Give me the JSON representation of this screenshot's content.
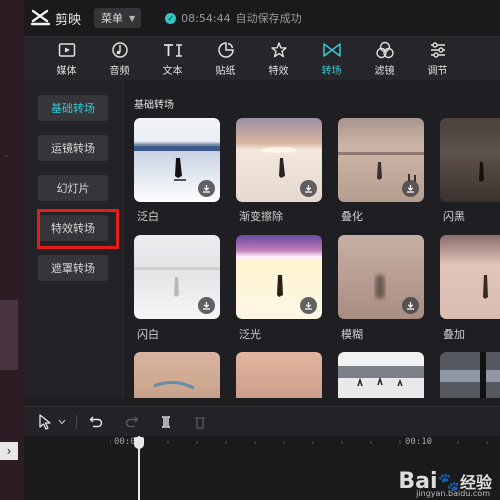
{
  "app": {
    "name": "剪映",
    "menu_label": "菜单",
    "save_time": "08:54:44",
    "save_text": "自动保存成功"
  },
  "toolbar": [
    {
      "label": "媒体",
      "icon": "media-icon"
    },
    {
      "label": "音频",
      "icon": "audio-icon"
    },
    {
      "label": "文本",
      "icon": "text-icon"
    },
    {
      "label": "贴纸",
      "icon": "sticker-icon"
    },
    {
      "label": "特效",
      "icon": "effects-icon"
    },
    {
      "label": "转场",
      "icon": "transition-icon",
      "active": true
    },
    {
      "label": "滤镜",
      "icon": "filter-icon"
    },
    {
      "label": "调节",
      "icon": "adjust-icon"
    }
  ],
  "sidebar": {
    "items": [
      {
        "label": "基础转场",
        "active": true
      },
      {
        "label": "运镜转场"
      },
      {
        "label": "幻灯片"
      },
      {
        "label": "特效转场",
        "highlighted": true
      },
      {
        "label": "遮罩转场"
      }
    ]
  },
  "content": {
    "section_title": "基础转场",
    "tiles": [
      {
        "label": "泛白"
      },
      {
        "label": "渐变擦除"
      },
      {
        "label": "叠化"
      },
      {
        "label": "闪黑"
      },
      {
        "label": "闪白"
      },
      {
        "label": "泛光"
      },
      {
        "label": "模糊"
      },
      {
        "label": "叠加"
      }
    ]
  },
  "timeline": {
    "time_start": "00:00",
    "time_mark": "00:10"
  },
  "watermark": {
    "brand": "Bai",
    "brand2": "经验",
    "url": "jingyan.baidu.com"
  },
  "colors": {
    "accent": "#39c7d0",
    "highlight": "#e31c1c",
    "bg": "#1e1e21"
  }
}
